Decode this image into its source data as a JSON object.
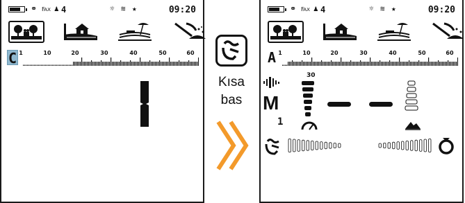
{
  "left_screen": {
    "status": {
      "battery_level": 0.8,
      "icons": [
        "headphones-icon",
        "wireless-icon",
        "user-icon"
      ],
      "user_number": "4",
      "right_icons": [
        "brightness-icon",
        "vibration-icon",
        "backlight-icon"
      ],
      "time": "09:20"
    },
    "modes": [
      "park-mode",
      "field-mode",
      "beach-mode",
      "gold-mode"
    ],
    "selected_mode": 0,
    "disc_letter": "C",
    "scale_labels": [
      "1",
      "10",
      "20",
      "30",
      "40",
      "50",
      "60"
    ],
    "target_id": "1"
  },
  "middle": {
    "button_icon": "gear-button-icon",
    "line1": "Kısa",
    "line2": "bas",
    "arrow_color": "#f39a2b"
  },
  "right_screen": {
    "status": {
      "battery_level": 0.8,
      "icons": [
        "headphones-icon",
        "wireless-icon",
        "user-icon"
      ],
      "user_number": "4",
      "right_icons": [
        "brightness-icon",
        "vibration-icon",
        "backlight-icon"
      ],
      "time": "09:20"
    },
    "modes": [
      "park-mode",
      "field-mode",
      "beach-mode",
      "gold-mode"
    ],
    "selected_mode": 0,
    "disc_letter": "A",
    "scale_labels": [
      "1",
      "10",
      "20",
      "30",
      "40",
      "50",
      "60"
    ],
    "depth_value": "30",
    "mode_letter": "M",
    "sub_digit": "1"
  }
}
